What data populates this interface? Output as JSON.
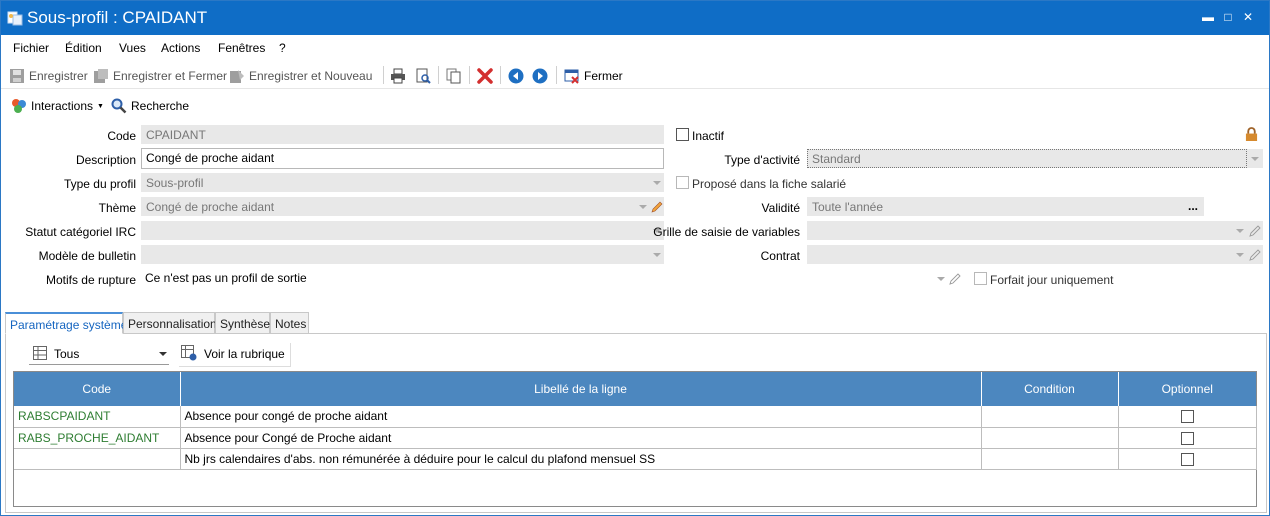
{
  "window": {
    "title": "Sous-profil : CPAIDANT"
  },
  "menu": [
    "Fichier",
    "Édition",
    "Vues",
    "Actions",
    "Fenêtres",
    "?"
  ],
  "toolbar": {
    "save": "Enregistrer",
    "save_close": "Enregistrer et Fermer",
    "save_new": "Enregistrer et Nouveau",
    "close": "Fermer"
  },
  "toolbar2": {
    "interactions": "Interactions",
    "search": "Recherche"
  },
  "form": {
    "code_label": "Code",
    "code_value": "CPAIDANT",
    "description_label": "Description",
    "description_value": "Congé de proche aidant",
    "type_profil_label": "Type du profil",
    "type_profil_value": "Sous-profil",
    "theme_label": "Thème",
    "theme_value": "Congé de proche aidant",
    "statut_label": "Statut catégoriel IRC",
    "statut_value": "",
    "modele_label": "Modèle de bulletin",
    "modele_value": "",
    "motifs_label": "Motifs de rupture",
    "motifs_value": "Ce n'est pas un profil de sortie",
    "inactif_label": "Inactif",
    "type_activite_label": "Type d'activité",
    "type_activite_value": "Standard",
    "propose_label": "Proposé dans la fiche salarié",
    "validite_label": "Validité",
    "validite_value": "Toute l'année",
    "validite_btn": "...",
    "grille_label": "Grille de saisie de variables",
    "grille_value": "",
    "contrat_label": "Contrat",
    "contrat_value": "",
    "forfait_label": "Forfait jour uniquement"
  },
  "tabs": [
    "Paramétrage système",
    "Personnalisation",
    "Synthèse",
    "Notes"
  ],
  "filter": {
    "selected": "Tous",
    "view_label": "Voir la rubrique"
  },
  "grid": {
    "columns": [
      "Code",
      "Libellé de la ligne",
      "Condition",
      "Optionnel"
    ],
    "rows": [
      {
        "code": "RABSCPAIDANT",
        "libelle": "Absence pour congé de proche aidant",
        "condition": ""
      },
      {
        "code": "RABS_PROCHE_AIDANT",
        "libelle": "Absence pour Congé de Proche aidant",
        "condition": ""
      },
      {
        "code": "",
        "libelle": "Nb jrs calendaires d'abs. non rémunérée à déduire pour le calcul du plafond mensuel SS",
        "condition": ""
      }
    ]
  },
  "colors": {
    "titlebar": "#0f6dc6",
    "grid_header": "#4c87bf",
    "code_text": "#2e7d32",
    "delete": "#d32f2f",
    "nav": "#1e6fc2"
  },
  "icons": [
    "app-icon",
    "minimize-icon",
    "maximize-icon",
    "close-icon",
    "save-icon",
    "save-close-icon",
    "save-new-icon",
    "print-icon",
    "print-preview-icon",
    "copy-icon",
    "delete-icon",
    "previous-icon",
    "next-icon",
    "close-form-icon",
    "interactions-icon",
    "search-icon",
    "lock-icon",
    "pencil-icon",
    "table-icon",
    "view-item-icon"
  ]
}
